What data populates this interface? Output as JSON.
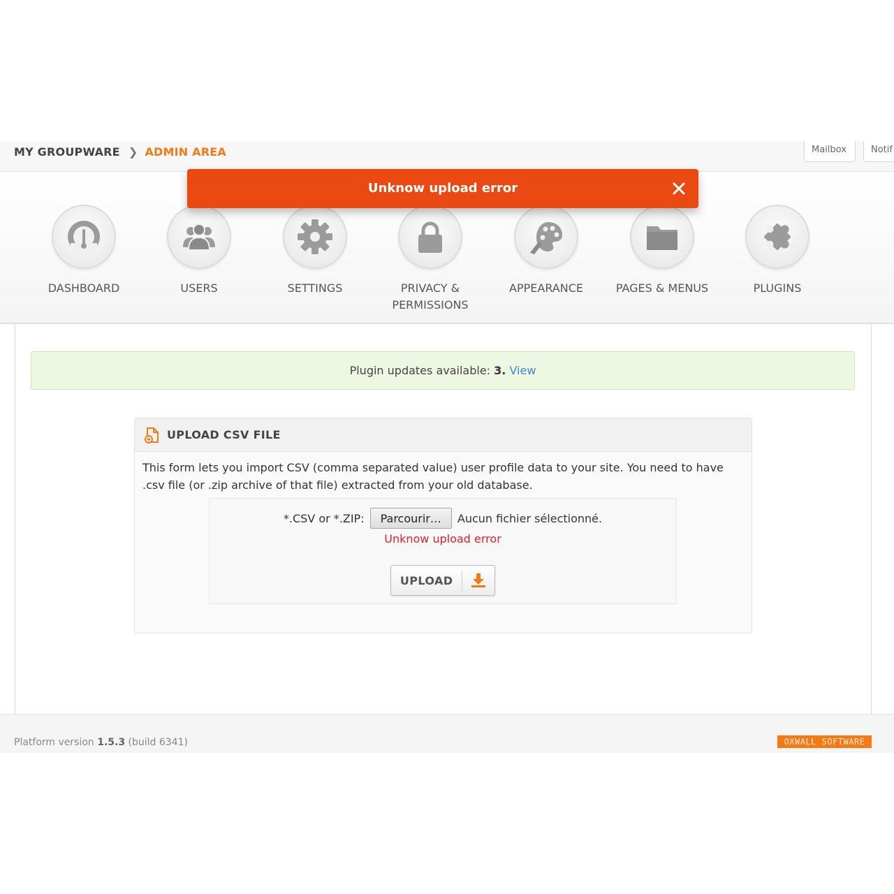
{
  "breadcrumb": {
    "home": "MY GROUPWARE",
    "current": "ADMIN AREA"
  },
  "top_buttons": {
    "mailbox": "Mailbox",
    "notifications": "Notif"
  },
  "toast": {
    "message": "Unknow upload error"
  },
  "nav": {
    "dashboard": "DASHBOARD",
    "users": "USERS",
    "settings": "SETTINGS",
    "privacy_line1": "PRIVACY &",
    "privacy_line2": "PERMISSIONS",
    "appearance": "APPEARANCE",
    "pages_menus": "PAGES & MENUS",
    "plugins": "PLUGINS"
  },
  "notice": {
    "text": "Plugin updates available: ",
    "count": "3.",
    "link": "View"
  },
  "upload_box": {
    "title": "UPLOAD CSV FILE",
    "description": "This form lets you import CSV (comma separated value) user profile data to your site. You need to have .csv file (or .zip archive of that file) extracted from your old database.",
    "file_label": "*.CSV or *.ZIP:",
    "browse_label": "Parcourir…",
    "file_status": "Aucun fichier sélectionné.",
    "error": "Unknow upload error",
    "upload_label": "UPLOAD"
  },
  "footer": {
    "version_prefix": "Platform version ",
    "version": "1.5.3",
    "build": " (build 6341)",
    "badge": "OXWALL SOFTWARE"
  },
  "colors": {
    "accent": "#f47a16",
    "toast": "#ea4a12",
    "error": "#e0202a",
    "link": "#3a8ac8"
  }
}
